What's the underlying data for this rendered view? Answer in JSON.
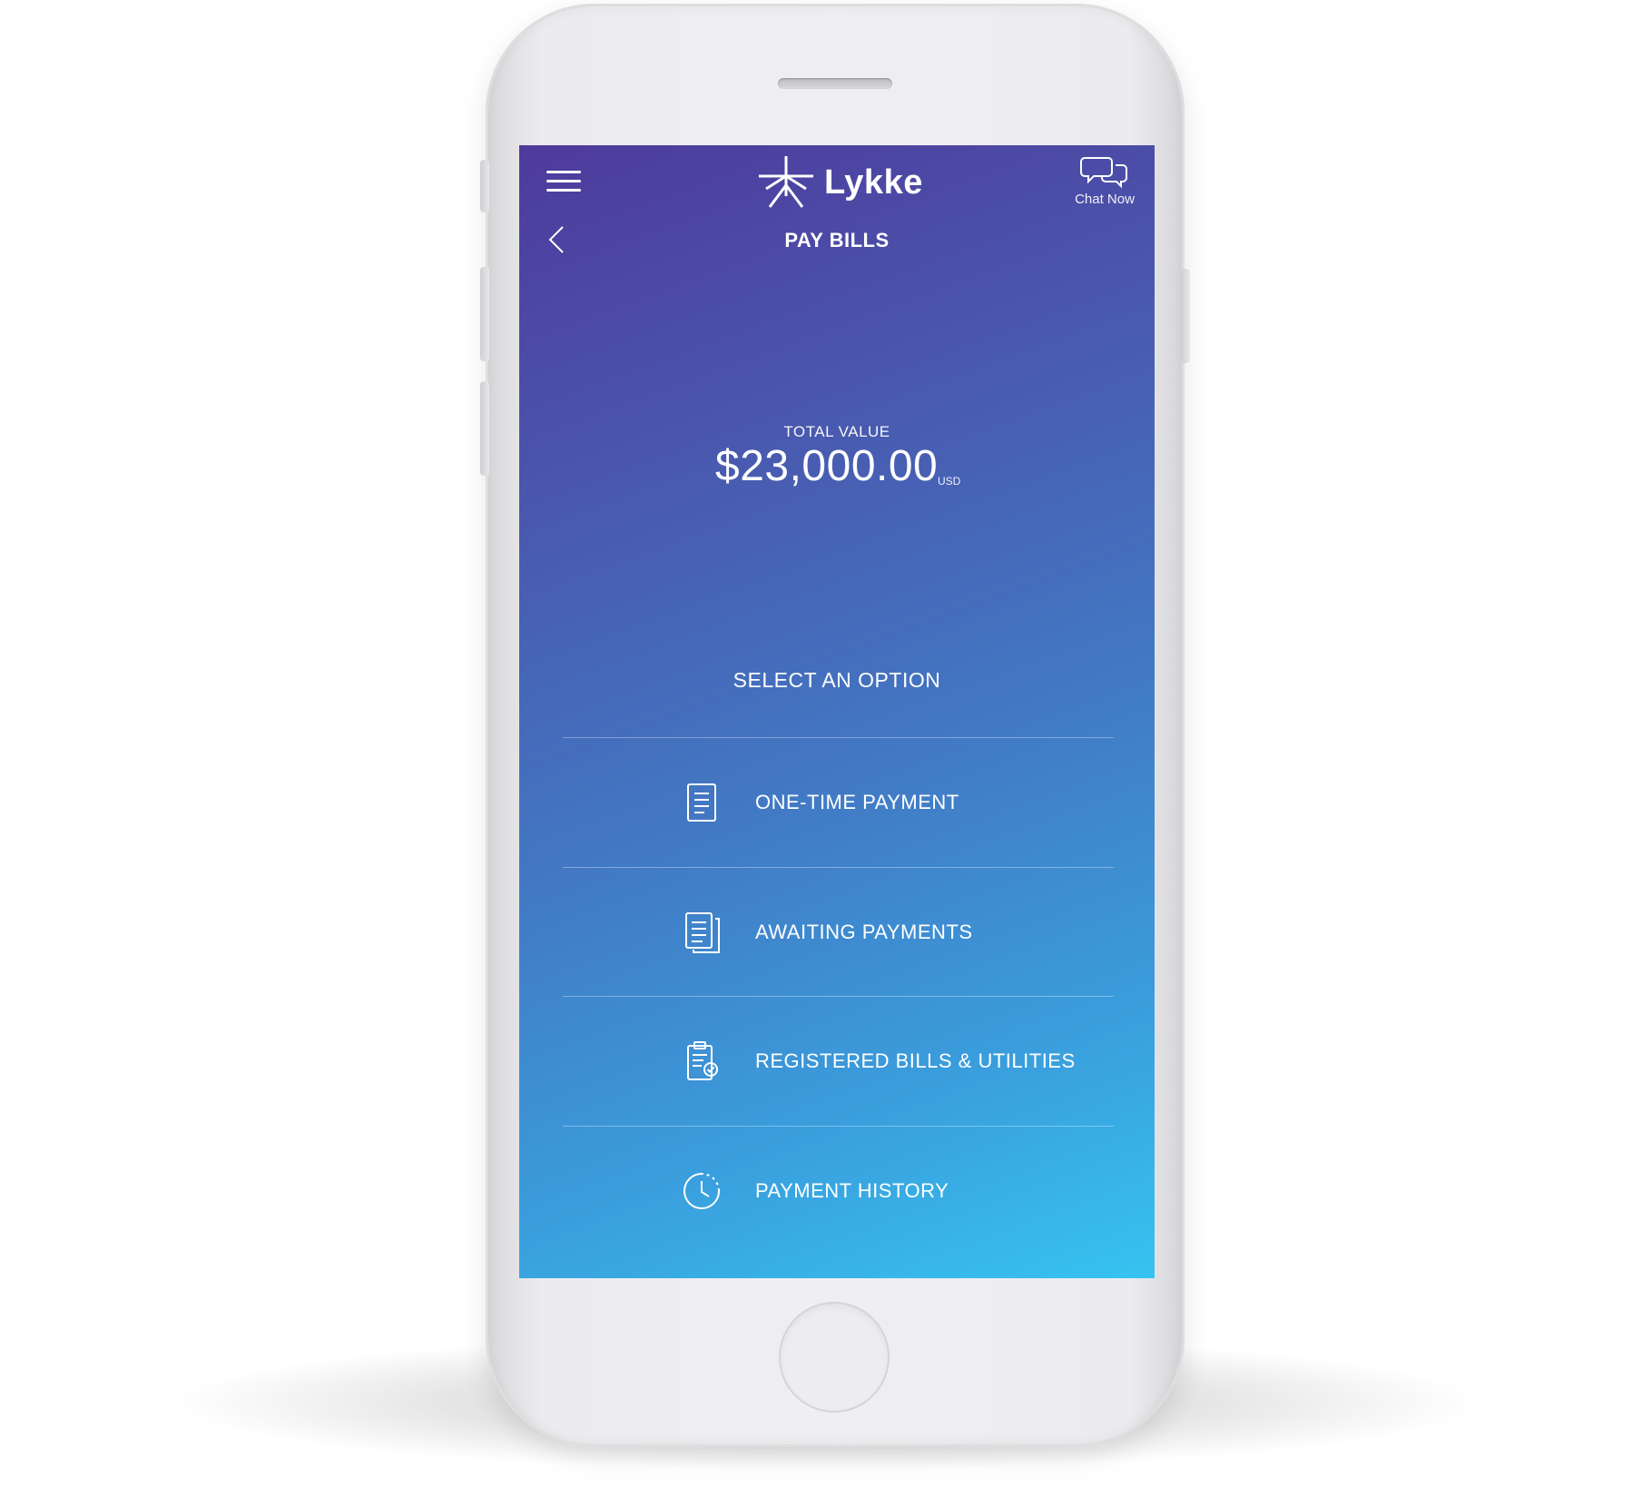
{
  "header": {
    "brand": "Lykke",
    "chat_label": "Chat Now",
    "title": "PAY BILLS"
  },
  "summary": {
    "label": "TOTAL VALUE",
    "amount": "$23,000.00",
    "currency": "USD"
  },
  "options": {
    "heading": "SELECT AN OPTION",
    "items": [
      {
        "label": "ONE-TIME PAYMENT",
        "icon": "document-icon"
      },
      {
        "label": "AWAITING PAYMENTS",
        "icon": "documents-stack-icon"
      },
      {
        "label": "REGISTERED BILLS & UTILITIES",
        "icon": "clipboard-check-icon"
      },
      {
        "label": "PAYMENT HISTORY",
        "icon": "clock-history-icon"
      }
    ]
  },
  "colors": {
    "gradient_start": "#4e3a9c",
    "gradient_end": "#36c3f0",
    "text": "#ffffff"
  }
}
